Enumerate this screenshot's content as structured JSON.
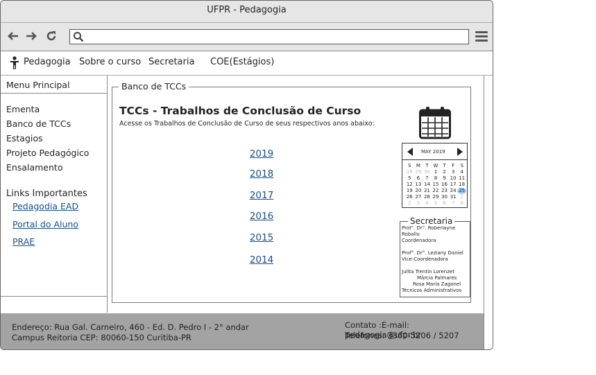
{
  "window": {
    "title": "UFPR - Pedagogia"
  },
  "toolbar": {
    "address_value": "",
    "icons": [
      "back-arrow-icon",
      "forward-arrow-icon",
      "reload-icon",
      "search-icon",
      "hamburger-menu-icon"
    ]
  },
  "nav": {
    "brand": "Pedagogia",
    "items": [
      "Sobre o curso",
      "Secretaria",
      "COE(Estágios)"
    ]
  },
  "sidebar": {
    "title": "Menu Principal",
    "menu": [
      "Ementa",
      "Banco de TCCs",
      "Estagios",
      "Projeto Pedagógico",
      "Ensalamento"
    ],
    "links_title": "Links Importantes",
    "links": [
      "Pedagodia EAD",
      "Portal do Aluno",
      "PRAE"
    ]
  },
  "main": {
    "fieldset_legend": "Banco de TCCs",
    "heading": "TCCs - Trabalhos de Conclusão de Curso",
    "subheading": "Acesse os Trabalhos de Conclusão de Curso de seus respectivos anos abaixo:",
    "years": [
      "2019",
      "2018",
      "2017",
      "2016",
      "2015",
      "2014"
    ]
  },
  "calendar": {
    "month_label": "MAY 2019",
    "weekdays": [
      "S",
      "M",
      "T",
      "W",
      "T",
      "F",
      "S"
    ],
    "weeks": [
      [
        "28",
        "29",
        "30",
        "1",
        "2",
        "3",
        "4"
      ],
      [
        "5",
        "6",
        "7",
        "8",
        "9",
        "10",
        "11"
      ],
      [
        "12",
        "13",
        "14",
        "15",
        "16",
        "17",
        "18"
      ],
      [
        "19",
        "20",
        "21",
        "22",
        "23",
        "24",
        "25"
      ],
      [
        "26",
        "27",
        "28",
        "29",
        "30",
        "31",
        "1"
      ],
      [
        "2",
        "3",
        "4",
        "5",
        "6",
        "7",
        "8"
      ]
    ],
    "selected": "25"
  },
  "secretaria": {
    "title": "Secretaria",
    "lines": [
      "Prof°. Dr°. Roberlayne",
      "Roballo",
      "Coordenadora",
      "",
      "Prof°. Dr°. Leziany Daniel",
      "Vice-Coordenadora",
      "",
      "Julita Trentin Lorenzet",
      "Márcia Palmares",
      "Rosa Maria Zagonel",
      "Técnicos Administrativos"
    ]
  },
  "footer": {
    "address_line1": "Endereço: Rua Gal. Carneiro, 460 - Ed. D. Pedro I - 2° andar",
    "address_line2": "Campus Reitoria CEP: 80060-150 Curitiba-PR",
    "contact_line1": "Contato :E-mail: pedagogia@ufpr.br",
    "contact_line2": "Telefones: 3360-5206 / 5207"
  },
  "colors": {
    "chrome": "#e6e6e6",
    "link": "#1a4d8a",
    "footer": "#a3a3a3",
    "calendar_selected": "#9ecbff"
  }
}
